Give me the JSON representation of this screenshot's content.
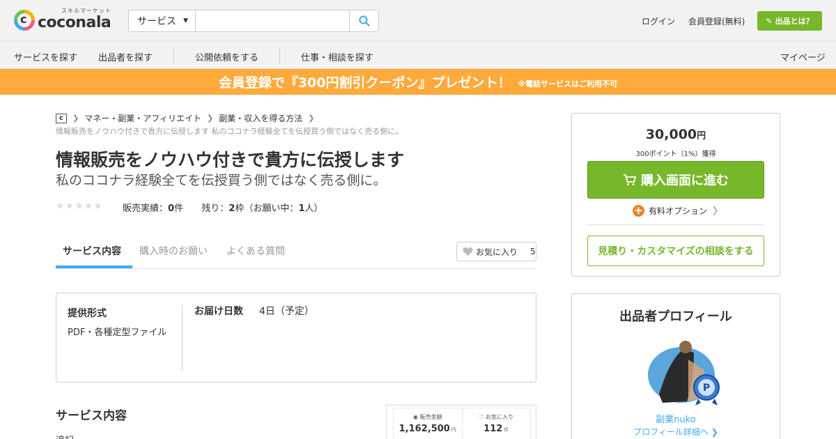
{
  "header": {
    "logo_sub": "スキルマーケット",
    "logo_text": "coconala",
    "search_category": "サービス",
    "search_placeholder": "",
    "login": "ログイン",
    "register": "会員登録(無料)",
    "about_button": "出品とは？"
  },
  "nav": {
    "items": [
      "サービスを探す",
      "出品者を探す",
      "公開依頼をする",
      "仕事・相談を探す"
    ],
    "mypage": "マイページ"
  },
  "banner": {
    "main": "会員登録で『300円割引クーポン』プレゼント！",
    "note": "※電話サービスはご利用不可"
  },
  "breadcrumb": {
    "home_icon": "c",
    "items": [
      "マネー・副業・アフィリエイト",
      "副業・収入を得る方法"
    ],
    "current": "情報販売をノウハウ付きで貴方に伝授します 私のココナラ経験全てを伝授買う側ではなく売る側に。"
  },
  "service": {
    "title": "情報販売をノウハウ付きで貴方に伝授します",
    "subtitle": "私のココナラ経験全てを伝授買う側ではなく売る側に。",
    "rating": 0,
    "sales_label": "販売実績：",
    "sales_count": "0",
    "sales_unit": "件",
    "remaining_label": "残り：",
    "remaining_count": "2",
    "remaining_unit": "枠（お願い中：",
    "requests_count": "1",
    "requests_unit": "人）"
  },
  "tabs": [
    {
      "label": "サービス内容",
      "active": true
    },
    {
      "label": "購入時のお願い",
      "active": false
    },
    {
      "label": "よくある質問",
      "active": false
    }
  ],
  "favorite": {
    "label": "お気に入り",
    "count": "5"
  },
  "info": {
    "format_label": "提供形式",
    "format_value": "PDF・各種定型ファイル",
    "delivery_label": "お届け日数",
    "delivery_value": "4日（予定）"
  },
  "content": {
    "heading": "サービス内容",
    "sub": "追記"
  },
  "stats": {
    "sales_amount_label": "販売金額",
    "sales_amount": "1,162,500",
    "sales_amount_unit": "円",
    "favorites_label": "お気に入り",
    "favorites": "112",
    "favorites_unit": "件"
  },
  "purchase": {
    "price": "30,000",
    "price_unit": "円",
    "points": "300ポイント（1%）獲得",
    "buy_button": "購入画面に進む",
    "option_label": "有料オプション",
    "consult_button": "見積り・カスタマイズの相談をする"
  },
  "seller": {
    "heading": "出品者プロフィール",
    "name": "副業nuko",
    "detail_link": "プロフィール詳細へ",
    "rank_badge": "P"
  },
  "colors": {
    "brand_green": "#76b82a",
    "banner_orange": "#ffaa3b",
    "accent_blue": "#3fa9f5",
    "option_orange": "#e8872b"
  }
}
